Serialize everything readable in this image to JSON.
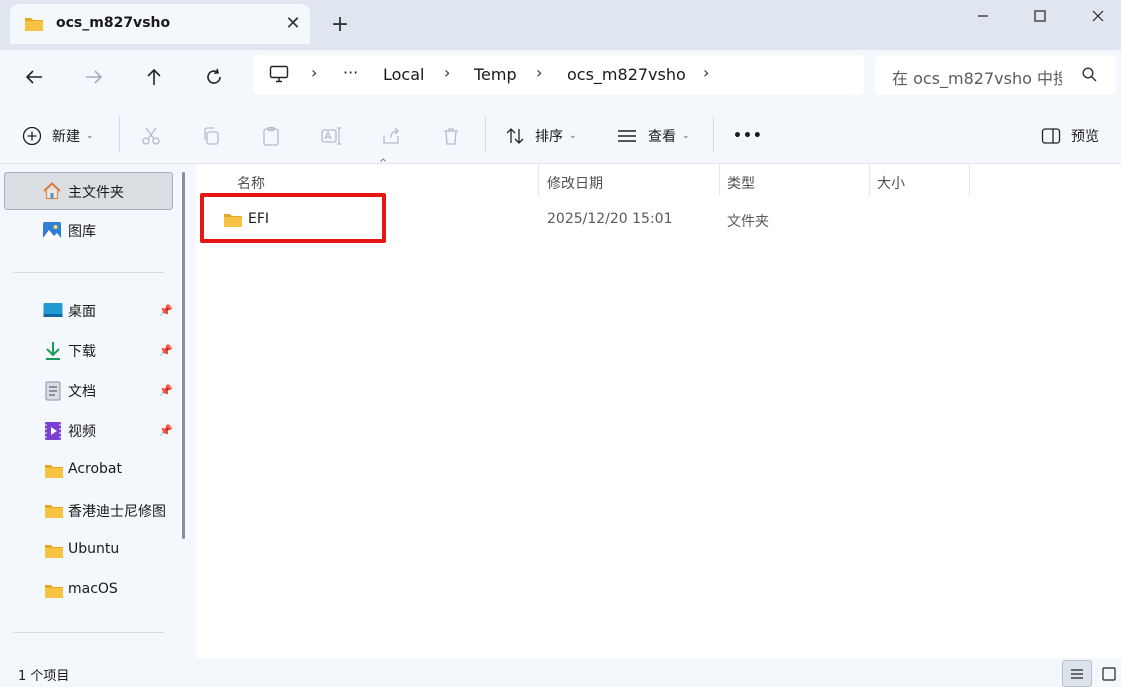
{
  "tab": {
    "title": "ocs_m827vsho",
    "close": "✕",
    "new_tab": "+"
  },
  "breadcrumb": {
    "ellipsis": "···",
    "items": [
      "Local",
      "Temp",
      "ocs_m827vsho"
    ]
  },
  "search": {
    "placeholder": "在 ocs_m827vsho 中搜索"
  },
  "toolbar": {
    "new_label": "新建",
    "sort_label": "排序",
    "view_label": "查看",
    "more_label": "•••",
    "preview_label": "预览"
  },
  "sidebar": {
    "items": [
      {
        "label": "主文件夹",
        "icon": "home-icon",
        "selected": true
      },
      {
        "label": "图库",
        "icon": "gallery-icon"
      },
      {
        "label": "桌面",
        "icon": "desktop-icon",
        "pinned": true
      },
      {
        "label": "下载",
        "icon": "download-icon",
        "pinned": true
      },
      {
        "label": "文档",
        "icon": "document-icon",
        "pinned": true
      },
      {
        "label": "视频",
        "icon": "video-icon",
        "pinned": true
      },
      {
        "label": "Acrobat",
        "icon": "folder-icon"
      },
      {
        "label": "香港迪士尼修图",
        "icon": "folder-icon"
      },
      {
        "label": "Ubuntu",
        "icon": "folder-icon"
      },
      {
        "label": "macOS",
        "icon": "folder-icon"
      }
    ]
  },
  "columns": [
    "名称",
    "修改日期",
    "类型",
    "大小"
  ],
  "files": [
    {
      "name": "EFI",
      "modified": "2025/12/20 15:01",
      "type": "文件夹",
      "size": ""
    }
  ],
  "status": {
    "item_count": "1 个项目"
  },
  "colors": {
    "highlight": "#e81515",
    "folder": "#f6c344",
    "accent": "#0a64c8"
  }
}
